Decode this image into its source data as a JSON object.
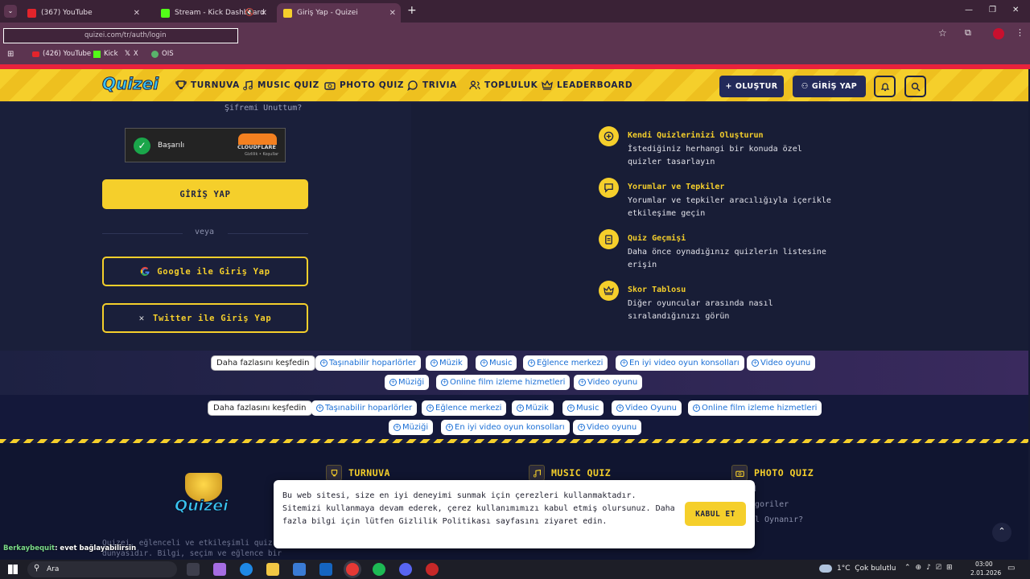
{
  "browser": {
    "tabs": [
      {
        "title": "(367) YouTube",
        "color": "#e3242b"
      },
      {
        "title": "Stream - Kick Dashboard",
        "color": "#53fc18"
      },
      {
        "title": "Giriş Yap - Quizei",
        "color": "#f5cf2b"
      }
    ],
    "new_tab": "+",
    "url": "quizei.com/tr/auth/login",
    "bookmarks": [
      {
        "label": "(426) YouTube",
        "color": "#e3242b"
      },
      {
        "label": "Kick",
        "color": "#53fc18"
      },
      {
        "label": "X",
        "color": "#ffffff"
      },
      {
        "label": "OIS",
        "color": "#59b36b"
      }
    ]
  },
  "site": {
    "brand": "Quizei",
    "nav": [
      {
        "label": "TURNUVA",
        "icon": "trophy-icon"
      },
      {
        "label": "MUSIC QUIZ",
        "icon": "music-icon"
      },
      {
        "label": "PHOTO QUIZ",
        "icon": "camera-icon"
      },
      {
        "label": "TRIVIA",
        "icon": "chat-icon"
      },
      {
        "label": "TOPLULUK",
        "icon": "users-icon"
      },
      {
        "label": "LEADERBOARD",
        "icon": "crown-icon"
      }
    ],
    "create_btn": "OLUŞTUR",
    "login_btn": "GİRİŞ YAP"
  },
  "login": {
    "forgot": "Şifremi Unuttum?",
    "captcha_status": "Başarılı",
    "captcha_brand": "CLOUDFLARE",
    "captcha_links": "Gizlilik • Koşullar",
    "submit": "GİRİŞ YAP",
    "or": "veya",
    "google": "Google ile Giriş Yap",
    "twitter": "Twitter ile Giriş Yap"
  },
  "features": [
    {
      "title": "Kendi Quizlerinizi Oluşturun",
      "desc": "İstediğiniz herhangi bir konuda özel quizler tasarlayın"
    },
    {
      "title": "Yorumlar ve Tepkiler",
      "desc": "Yorumlar ve tepkiler aracılığıyla içerikle etkileşime geçin"
    },
    {
      "title": "Quiz Geçmişi",
      "desc": "Daha önce oynadığınız quizlerin listesine erişin"
    },
    {
      "title": "Skor Tablosu",
      "desc": "Diğer oyuncular arasında nasıl sıralandığınızı görün"
    }
  ],
  "ads": {
    "row1": [
      "Daha fazlasını keşfedin",
      "Taşınabilir hoparlörler",
      "Müzik",
      "Music",
      "Eğlence merkezi",
      "En iyi video oyun konsolları",
      "Video oyunu",
      "Müziği",
      "Online film izleme hizmetleri",
      "Video oyunu"
    ],
    "row2": [
      "Daha fazlasını keşfedin",
      "Taşınabilir hoparlörler",
      "Eğlence merkezi",
      "Müzik",
      "Music",
      "Video Oyunu",
      "Online film izleme hizmetleri",
      "Müziği",
      "En iyi video oyun konsolları",
      "Video oyunu"
    ]
  },
  "footer": {
    "headings": [
      "TURNUVA",
      "MUSIC QUIZ",
      "PHOTO QUIZ"
    ],
    "about": "Quizei, eğlenceli ve etkileşimli quiz dünyasıdır. Bilgi, seçim ve eğlence bir",
    "partial_links": [
      "d",
      "goriler",
      "l Oynanır?"
    ]
  },
  "cookie": {
    "text": "Bu web sitesi, size en iyi deneyimi sunmak için çerezleri kullanmaktadır. Sitemizi kullanmaya devam ederek, çerez kullanımımızı kabul etmiş olursunuz. Daha fazla bilgi için lütfen Gizlilik Politikası sayfasını ziyaret edin.",
    "accept": "KABUL ET"
  },
  "chat": {
    "user": "Berkaybequit",
    "message": ": evet bağlayabilirsin"
  },
  "taskbar": {
    "search": "Ara",
    "weather": "1°C  Çok bulutlu",
    "time": "03:00",
    "date": "2.01.2026"
  }
}
